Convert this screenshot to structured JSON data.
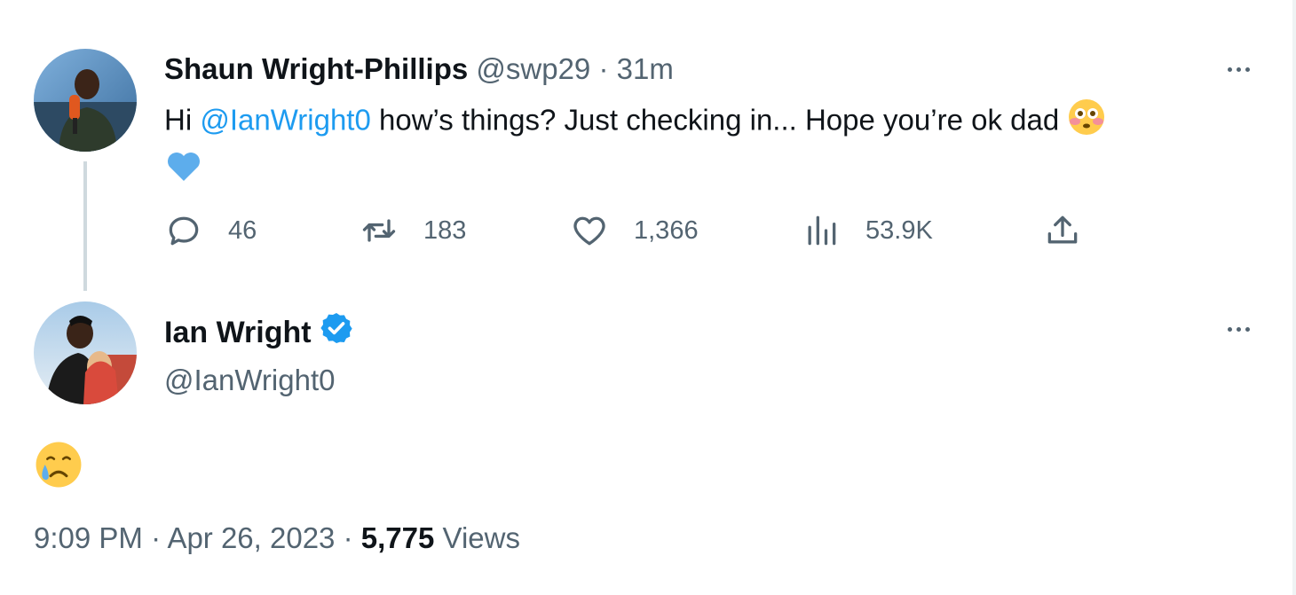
{
  "parent_tweet": {
    "display_name": "Shaun Wright-Phillips",
    "handle": "@swp29",
    "separator": "·",
    "time_ago": "31m",
    "text_before_mention": "Hi ",
    "mention": "@IanWright0",
    "text_after_mention": " how’s things? Just checking in... Hope you’re ok dad",
    "emojis": [
      "flushed-face",
      "blue-heart"
    ],
    "stats": {
      "replies": "46",
      "retweets": "183",
      "likes": "1,366",
      "views": "53.9K"
    }
  },
  "reply_tweet": {
    "display_name": "Ian Wright",
    "verified": true,
    "handle": "@IanWright0",
    "emoji": "crying-face",
    "time": "9:09 PM",
    "separator": "·",
    "date": "Apr 26, 2023",
    "views_count": "5,775",
    "views_label": "Views"
  },
  "icons": {
    "reply": "reply-icon",
    "retweet": "retweet-icon",
    "like": "heart-icon",
    "views": "analytics-icon",
    "share": "share-icon",
    "more": "more-icon",
    "verified": "verified-badge-icon"
  },
  "colors": {
    "text_primary": "#0f1419",
    "text_secondary": "#536471",
    "accent": "#1d9bf0",
    "thread_line": "#cfd9de"
  }
}
